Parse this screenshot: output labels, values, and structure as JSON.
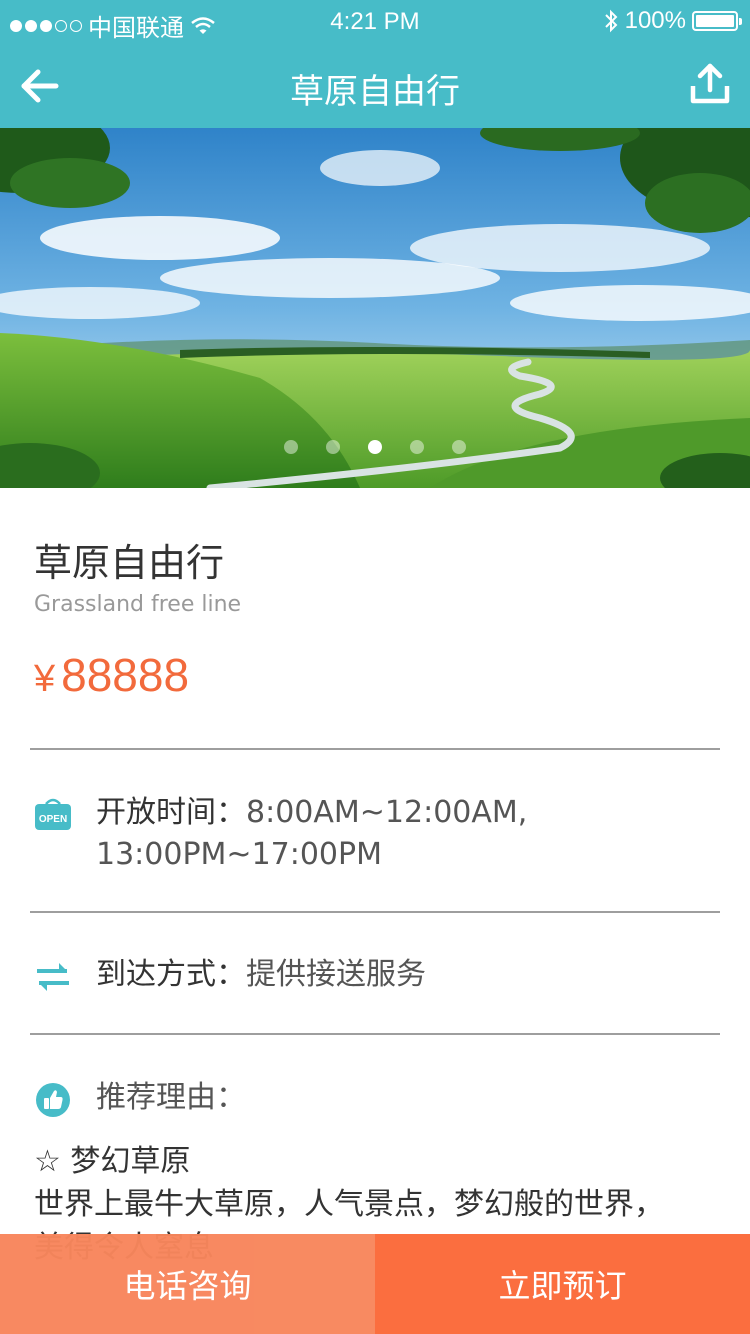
{
  "status_bar": {
    "carrier": "中国联通",
    "time": "4:21 PM",
    "battery": "100%",
    "signal_bars_filled": 3,
    "signal_bars_total": 5
  },
  "nav": {
    "title": "草原自由行",
    "back_icon": "arrow-left-icon",
    "share_icon": "share-upload-icon"
  },
  "hero": {
    "carousel_page": 3,
    "carousel_total": 5
  },
  "product": {
    "title": "草原自由行",
    "subtitle": "Grassland free line",
    "currency": "¥",
    "price": "88888"
  },
  "details": {
    "open_time_label": "开放时间：",
    "open_time_value_1": "8:00AM~12:00AM,",
    "open_time_value_2": "13:00PM~17:00PM",
    "open_icon_text": "OPEN",
    "arrival_label": "到达方式：",
    "arrival_value": "提供接送服务",
    "reason_label": "推荐理由：",
    "reason_line_1": "☆ 梦幻草原",
    "reason_line_2": "世界上最牛大草原，人气景点，梦幻般的世界，",
    "reason_line_3": "美得令人窒息"
  },
  "actions": {
    "call_label": "电话咨询",
    "book_label": "立即预订"
  },
  "colors": {
    "primary": "#47bcc8",
    "price": "#f26a3c",
    "call_button": "#f8865c",
    "book_button": "#fb6e3f"
  }
}
